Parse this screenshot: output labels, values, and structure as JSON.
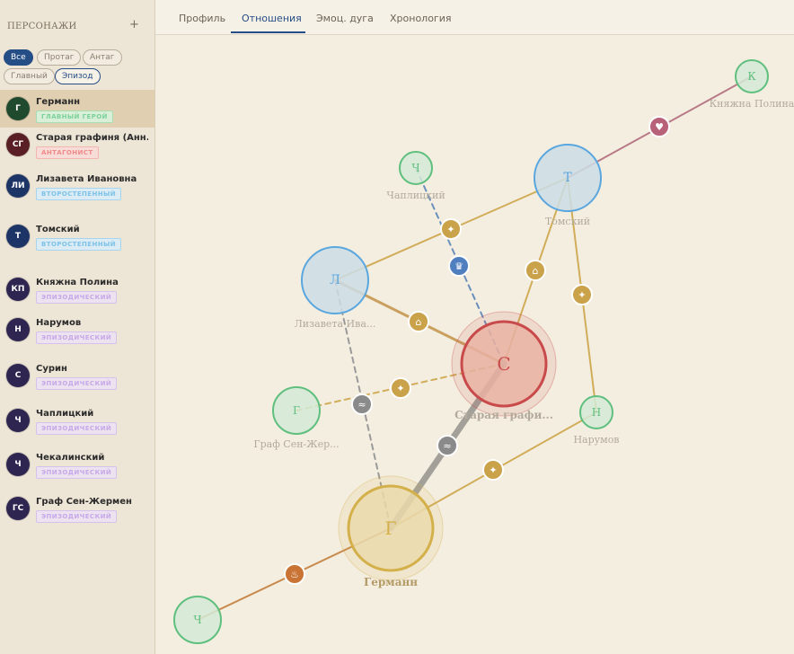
{
  "sidebar": {
    "title": "ПЕРСОНАЖИ",
    "add_label": "+",
    "filters": [
      {
        "label": "Все",
        "state": "active"
      },
      {
        "label": "Протаг",
        "state": "normal"
      },
      {
        "label": "Антаг",
        "state": "normal"
      },
      {
        "label": "Главный",
        "state": "normal"
      },
      {
        "label": "Эпизод",
        "state": "outlined"
      }
    ],
    "characters": [
      {
        "initials": "Г",
        "name": "Германн",
        "role": "ГЛАВНЫЙ ГЕРОЙ",
        "role_type": "main",
        "avatar_color": "#1f4a2e",
        "selected": true
      },
      {
        "initials": "СГ",
        "name": "Старая графиня (Анн...",
        "role": "АНТАГОНИСТ",
        "role_type": "ant",
        "avatar_color": "#5a1f24"
      },
      {
        "initials": "ЛИ",
        "name": "Лизавета Ивановна",
        "role": "ВТОРОСТЕПЕННЫЙ",
        "role_type": "sec",
        "avatar_color": "#1d3566"
      },
      {
        "initials": "Т",
        "name": "Томский",
        "role": "ВТОРОСТЕПЕННЫЙ",
        "role_type": "sec",
        "avatar_color": "#1d3566"
      },
      {
        "initials": "КП",
        "name": "Княжна Полина",
        "role": "ЭПИЗОДИЧЕСКИЙ",
        "role_type": "epi",
        "avatar_color": "#2e2550"
      },
      {
        "initials": "Н",
        "name": "Нарумов",
        "role": "ЭПИЗОДИЧЕСКИЙ",
        "role_type": "epi",
        "avatar_color": "#2e2550"
      },
      {
        "initials": "С",
        "name": "Сурин",
        "role": "ЭПИЗОДИЧЕСКИЙ",
        "role_type": "epi",
        "avatar_color": "#2e2550"
      },
      {
        "initials": "Ч",
        "name": "Чаплицкий",
        "role": "ЭПИЗОДИЧЕСКИЙ",
        "role_type": "epi",
        "avatar_color": "#2e2550"
      },
      {
        "initials": "Ч",
        "name": "Чекалинский",
        "role": "ЭПИЗОДИЧЕСКИЙ",
        "role_type": "epi",
        "avatar_color": "#2e2550"
      },
      {
        "initials": "ГС",
        "name": "Граф Сен-Жермен",
        "role": "ЭПИЗОДИЧЕСКИЙ",
        "role_type": "epi",
        "avatar_color": "#2e2550"
      }
    ]
  },
  "tabs": [
    {
      "label": "Профиль",
      "active": false
    },
    {
      "label": "Отношения",
      "active": true
    },
    {
      "label": "Эмоц. дуга",
      "active": false
    },
    {
      "label": "Хронология",
      "active": false
    }
  ],
  "graph": {
    "colors": {
      "secondary": "#5aa6de",
      "episodic": "#5fbf7e",
      "antagonist": "#c94a4a",
      "main": "#d4b04a",
      "edge_gold": "#d1ad5a",
      "edge_grey": "#9a9a9a",
      "edge_pink": "#b87a86",
      "edge_orange": "#c98a4e"
    },
    "nodes": [
      {
        "id": "kp",
        "letter": "К",
        "label": "Княжна Полина",
        "kind": "episodic"
      },
      {
        "id": "tomsky",
        "letter": "Т",
        "label": "Томский",
        "kind": "secondary"
      },
      {
        "id": "chap",
        "letter": "Ч",
        "label": "Чаплицкий",
        "kind": "episodic"
      },
      {
        "id": "liz",
        "letter": "Л",
        "label": "Лизавета Ива...",
        "kind": "secondary"
      },
      {
        "id": "countess",
        "letter": "С",
        "label": "Старая графи...",
        "kind": "antagonist"
      },
      {
        "id": "saint",
        "letter": "Г",
        "label": "Граф Сен-Жер...",
        "kind": "episodic"
      },
      {
        "id": "narumov",
        "letter": "Н",
        "label": "Нарумов",
        "kind": "episodic"
      },
      {
        "id": "german",
        "letter": "Г",
        "label": "Германн",
        "kind": "main"
      },
      {
        "id": "chek",
        "letter": "Ч",
        "label": "",
        "kind": "episodic"
      }
    ],
    "edges": [
      {
        "from": "tomsky",
        "to": "kp",
        "icon": "heart-icon",
        "glyph": "♥",
        "kind": "pink"
      },
      {
        "from": "liz",
        "to": "tomsky",
        "icon": "star-icon",
        "glyph": "✦",
        "kind": "gold"
      },
      {
        "from": "countess",
        "to": "tomsky",
        "icon": "home-icon",
        "glyph": "⌂",
        "kind": "gold"
      },
      {
        "from": "tomsky",
        "to": "narumov",
        "icon": "star-icon",
        "glyph": "✦",
        "kind": "gold"
      },
      {
        "from": "chap",
        "to": "countess",
        "icon": "crown-icon",
        "glyph": "♛",
        "kind": "blue-dashed"
      },
      {
        "from": "liz",
        "to": "countess",
        "icon": "home-icon",
        "glyph": "⌂",
        "kind": "gold-thick"
      },
      {
        "from": "saint",
        "to": "countess",
        "icon": "star-icon",
        "glyph": "✦",
        "kind": "gold-dashed"
      },
      {
        "from": "liz",
        "to": "german",
        "icon": "wave-icon",
        "glyph": "≈",
        "kind": "grey-dashed"
      },
      {
        "from": "german",
        "to": "countess",
        "icon": "wave-icon",
        "glyph": "≈",
        "kind": "grey-thick"
      },
      {
        "from": "german",
        "to": "narumov",
        "icon": "star-icon",
        "glyph": "✦",
        "kind": "gold"
      },
      {
        "from": "chek",
        "to": "german",
        "icon": "flame-icon",
        "glyph": "♨",
        "kind": "orange"
      }
    ]
  }
}
